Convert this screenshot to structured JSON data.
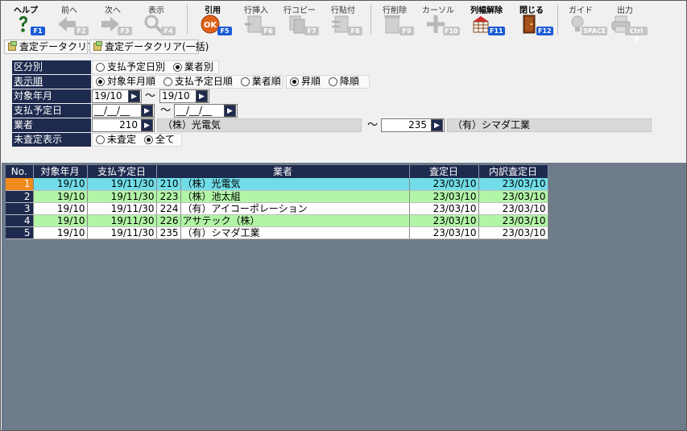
{
  "toolbar": {
    "buttons": [
      {
        "label": "ヘルプ",
        "key": "F1",
        "enabled": true
      },
      {
        "label": "前へ",
        "key": "F2",
        "enabled": false
      },
      {
        "label": "次へ",
        "key": "F3",
        "enabled": false
      },
      {
        "label": "表示",
        "key": "F4",
        "enabled": false
      },
      {
        "label": "引用",
        "key": "F5",
        "enabled": true
      },
      {
        "label": "行挿入",
        "key": "F6",
        "enabled": false
      },
      {
        "label": "行コピー",
        "key": "F7",
        "enabled": false
      },
      {
        "label": "行貼付",
        "key": "F8",
        "enabled": false
      },
      {
        "label": "行削除",
        "key": "F9",
        "enabled": false
      },
      {
        "label": "カーソル",
        "key": "F10",
        "enabled": false
      },
      {
        "label": "列幅解除",
        "key": "F11",
        "enabled": true
      },
      {
        "label": "閉じる",
        "key": "F12",
        "enabled": true
      },
      {
        "label": "ガイド",
        "key": "SPACE",
        "enabled": false
      },
      {
        "label": "出力",
        "key": "Ctrl P",
        "enabled": false
      }
    ]
  },
  "clear": {
    "clear_label": "査定データクリア",
    "clear_all_label": "査定データクリア(一括)"
  },
  "form": {
    "kubun": {
      "label": "区分別",
      "options": [
        "支払予定日別",
        "業者別"
      ],
      "selected": 1
    },
    "display_order": {
      "label": "表示順",
      "options": [
        "対象年月順",
        "支払予定日順",
        "業者順"
      ],
      "selected": 0,
      "direction_options": [
        "昇順",
        "降順"
      ],
      "direction_selected": 0
    },
    "target_month": {
      "label": "対象年月",
      "from": "19/10",
      "to": "19/10",
      "tilde": "〜"
    },
    "payment_date": {
      "label": "支払予定日",
      "from": "__/__/__",
      "to": "__/__/__",
      "tilde": "〜"
    },
    "vendor": {
      "label": "業者",
      "from_code": "210",
      "from_name": "（株）光電気",
      "to_code": "235",
      "to_name": "（有）シマダ工業",
      "tilde": "〜"
    },
    "unassessed": {
      "label": "未査定表示",
      "options": [
        "未査定",
        "全て"
      ],
      "selected": 1
    }
  },
  "grid": {
    "columns": [
      "No.",
      "対象年月",
      "支払予定日",
      "業者",
      "査定日",
      "内訳査定日"
    ],
    "rows": [
      {
        "no": "1",
        "month": "19/10",
        "pay": "19/11/30",
        "code": "210",
        "name": "（株）光電気",
        "assess": "23/03/10",
        "detail": "23/03/10",
        "color": "cyan",
        "selected": true
      },
      {
        "no": "2",
        "month": "19/10",
        "pay": "19/11/30",
        "code": "223",
        "name": "（株）池太組",
        "assess": "23/03/10",
        "detail": "23/03/10",
        "color": "green",
        "selected": false
      },
      {
        "no": "3",
        "month": "19/10",
        "pay": "19/11/30",
        "code": "224",
        "name": "（有）アイコーポレーション",
        "assess": "23/03/10",
        "detail": "23/03/10",
        "color": "white",
        "selected": false
      },
      {
        "no": "4",
        "month": "19/10",
        "pay": "19/11/30",
        "code": "226",
        "name": "アサテック（株）",
        "assess": "23/03/10",
        "detail": "23/03/10",
        "color": "green",
        "selected": false
      },
      {
        "no": "5",
        "month": "19/10",
        "pay": "19/11/30",
        "code": "235",
        "name": "（有）シマダ工業",
        "assess": "23/03/10",
        "detail": "23/03/10",
        "color": "white",
        "selected": false
      }
    ]
  }
}
